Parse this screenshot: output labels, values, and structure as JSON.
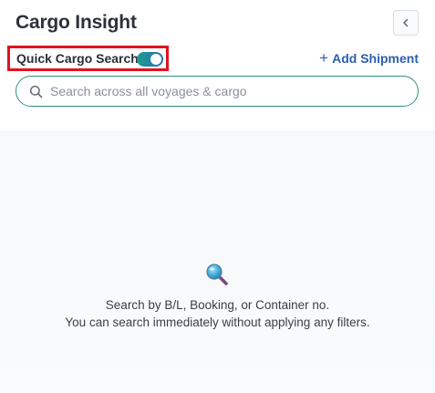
{
  "header": {
    "title": "Cargo Insight",
    "collapse_icon": "chevron-left-icon"
  },
  "quick_search": {
    "label": "Quick Cargo Search",
    "toggle_on": true,
    "toggle_color_start": "#1f9d8e",
    "toggle_color_end": "#2b6fb3",
    "highlight_color": "#e0131f"
  },
  "actions": {
    "add_shipment_icon": "plus-icon",
    "add_shipment_label": "Add Shipment",
    "accent_color": "#2a5fb0"
  },
  "search": {
    "icon": "search-icon",
    "placeholder": "Search across all voyages & cargo",
    "value": ""
  },
  "empty_state": {
    "icon": "magnifier-icon",
    "line1": "Search by B/L, Booking, or Container no.",
    "line2": "You can search immediately without applying any filters."
  }
}
